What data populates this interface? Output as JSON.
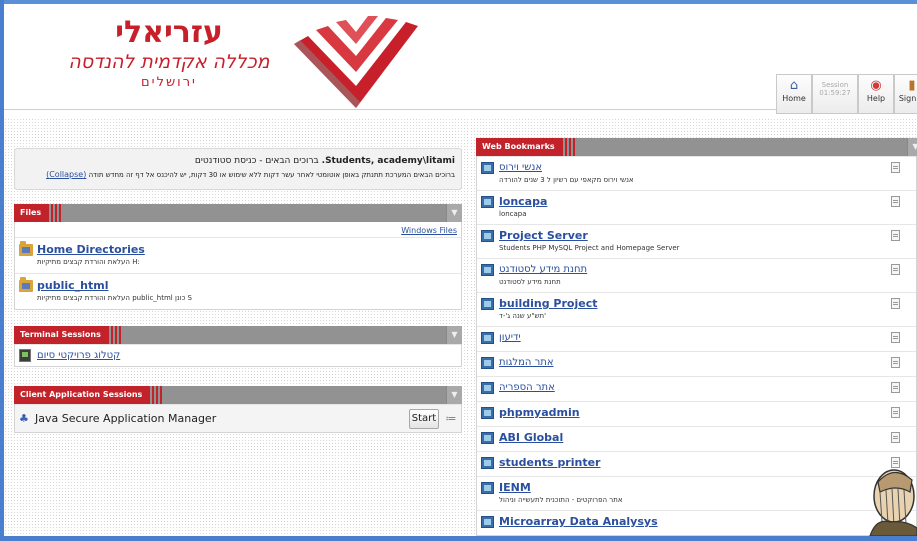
{
  "header": {
    "logo_main": "עזריאלי",
    "logo_sub": "מכללה אקדמית להנדסה",
    "logo_city": "ירושלים",
    "toolbar": [
      {
        "label": "Home",
        "icon": "home-icon"
      },
      {
        "label_top": "Session",
        "label_bottom": "01:59:27",
        "icon": "session-icon"
      },
      {
        "label": "Help",
        "icon": "help-icon"
      },
      {
        "label": "Sign O",
        "icon": "sign-out-icon"
      }
    ]
  },
  "welcome": {
    "greeting_prefix": "ברוכים הבאים - כניסת סטודנטים",
    "user": "Students, academy\\litami.",
    "notice": "ברוכים הבאים המערכת תתנתק באופן אוטומטי לאחר עשר דקות ללא שימוש או 30 דקות, יש להיכנס אל דף זה מחדש תודה",
    "collapse": "(Collapse)"
  },
  "files": {
    "title": "Files",
    "windows_files": "Windows Files",
    "items": [
      {
        "title": "Home Directories",
        "sub": "העלאת והורדת קבצים מתיקיות H:"
      },
      {
        "title": "public_html",
        "sub": "העלאת והורדת קבצים מתיקיות public_html כונן S"
      }
    ]
  },
  "terminal": {
    "title": "Terminal Sessions",
    "items": [
      {
        "label": "קטלוג פרויקטי סיום"
      }
    ]
  },
  "client_apps": {
    "title": "Client Application Sessions",
    "items": [
      {
        "label": "Java Secure Application Manager",
        "button": "Start"
      }
    ]
  },
  "bookmarks": {
    "title": "Web Bookmarks",
    "items": [
      {
        "title": "אנשי וירוס",
        "sub": "אנשי וירוס מקאפי עם רשיון ל 3 שנים להורדה",
        "heb": true
      },
      {
        "title": "loncapa",
        "sub": "loncapa",
        "heb": false
      },
      {
        "title": "Project Server",
        "sub": "Students PHP MySQL Project and Homepage Server",
        "heb": false
      },
      {
        "title": "תחנת מידע לסטודנט",
        "sub": "תחנת מידע לסטודנט",
        "heb": true
      },
      {
        "title": "building Project",
        "sub": "תש\"ע שנה ג'-ד'",
        "heb": false
      },
      {
        "title": "ידיעון",
        "sub": "",
        "heb": true
      },
      {
        "title": "אתר המלגות",
        "sub": "",
        "heb": true
      },
      {
        "title": "אתר הספריה",
        "sub": "",
        "heb": true
      },
      {
        "title": "phpmyadmin",
        "sub": "",
        "heb": false
      },
      {
        "title": "ABI Global",
        "sub": "",
        "heb": false
      },
      {
        "title": "students printer",
        "sub": "",
        "heb": false
      },
      {
        "title": "IENM",
        "sub": "אתר הפרוקטים - התוכנית לתעשייה וניהול",
        "heb": false
      },
      {
        "title": "Microarray Data Analysys",
        "sub": "",
        "heb": false
      }
    ]
  },
  "colors": {
    "brand_red": "#c2232b",
    "link_blue": "#2a4f9e",
    "frame_blue": "#4a7fcf"
  }
}
